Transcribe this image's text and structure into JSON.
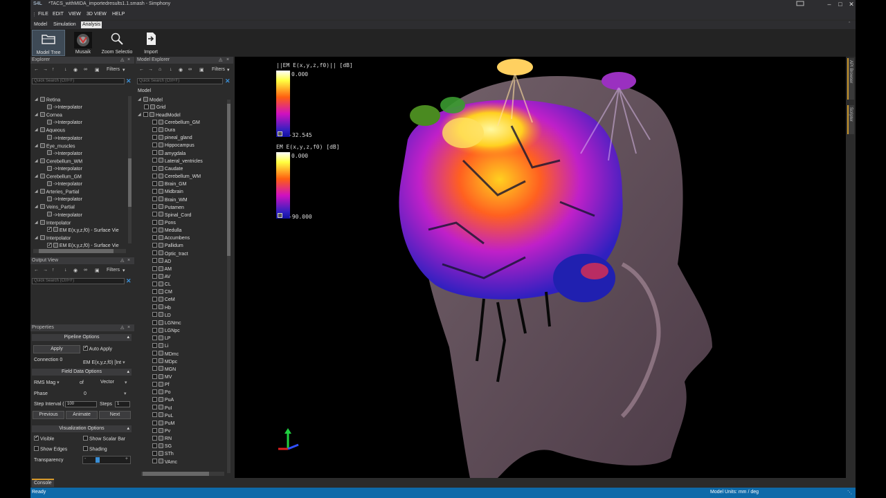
{
  "window": {
    "logo": "S4L",
    "title": "*TACS_withMIDA_importedresults1.1.smash - Simphony"
  },
  "menu": [
    "FILE",
    "EDIT",
    "VIEW",
    "3D VIEW",
    "HELP"
  ],
  "ribbon_tabs": [
    "Model",
    "Simulation",
    "Analysis"
  ],
  "ribbon_buttons": [
    "Model Tree",
    "Musaik",
    "Zoom Selectio",
    "Import"
  ],
  "explorer": {
    "title": "Explorer",
    "filters": "Filters",
    "search_placeholder": "Quick Search (Ctrl+F)",
    "items": [
      "Retina",
      "->Interpolator",
      "Cornea",
      "->Interpolator",
      "Aqueous",
      "->Interpolator",
      "Eye_muscles",
      "->Interpolator",
      "Cerebellum_WM",
      "->Interpolator",
      "Cerebellum_GM",
      "->Interpolator",
      "Arteries_Partial",
      "->Interpolator",
      "Veins_Partial",
      "->Interpolator",
      "Interpolator",
      "EM  E(x,y,z,f0) - Surface Vie",
      "Interpolator",
      "EM  E(x,y,z,f0) - Surface Vie"
    ]
  },
  "output_view": {
    "title": "Output View",
    "filters": "Filters",
    "search_placeholder": "Quick Search (Ctrl+F)"
  },
  "properties": {
    "title": "Properties",
    "pipeline_options": "Pipeline Options",
    "apply": "Apply",
    "auto_apply": "Auto Apply",
    "connection_label": "Connection 0",
    "connection_value": "EM  E(x,y,z,f0) [Int",
    "field_data_options": "Field Data Options",
    "rms_mag": "RMS Mag",
    "of": "of",
    "vector": "Vector",
    "phase_label": "Phase",
    "phase_value": "0",
    "step_interval_label": "Step Interval (",
    "step_interval_value": "100",
    "steps_label": "Steps",
    "steps_value": "1",
    "previous": "Previous",
    "animate": "Animate",
    "next": "Next",
    "visualization_options": "Visualization Options",
    "visible": "Visible",
    "show_scalar_bar": "Show Scalar Bar",
    "show_edges": "Show Edges",
    "shading": "Shading",
    "transparency": "Transparency",
    "transparency_level": 0.2
  },
  "model_explorer": {
    "title": "Model Explorer",
    "filters": "Filters",
    "search_placeholder": "Quick Search (Ctrl+F)",
    "header": "Model",
    "root": "Model",
    "grid": "Grid",
    "head_model": "HeadModel",
    "items": [
      "Cerebellum_GM",
      "Dura",
      "pineal_gland",
      "Hippocampus",
      "amygdala",
      "Lateral_ventricles",
      "Caudate",
      "Cerebellum_WM",
      "Brain_GM",
      "Midbrain",
      "Brain_WM",
      "Putamen",
      "Spinal_Cord",
      "Pons",
      "Medulla",
      "Accumbens",
      "Pallidum",
      "Optic_tract",
      "AD",
      "AM",
      "AV",
      "CL",
      "CM",
      "CeM",
      "Hb",
      "LD",
      "LGNmc",
      "LGNpc",
      "LP",
      "Li",
      "MDmc",
      "MDpc",
      "MGN",
      "MV",
      "Pf",
      "Po",
      "PuA",
      "PuI",
      "PuL",
      "PuM",
      "Pv",
      "RN",
      "SG",
      "STh",
      "VAmc"
    ]
  },
  "viewport": {
    "scalar_bar_1": {
      "label": "||EM E(x,y,z,f0)|| [dB]",
      "max": "0.000",
      "min": "-32.545"
    },
    "scalar_bar_2": {
      "label": "EM E(x,y,z,f0) [dB]",
      "max": "0.000",
      "min": "-90.000"
    }
  },
  "right_tabs": [
    "API Browser",
    "Scripter"
  ],
  "console_tab": "Console",
  "status": {
    "left": "Ready",
    "right": "Model Units: mm / deg"
  },
  "colors": {
    "accent": "#0e6aa9",
    "tab_accent": "#d99b2b",
    "search_x": "#3a8fd6"
  }
}
